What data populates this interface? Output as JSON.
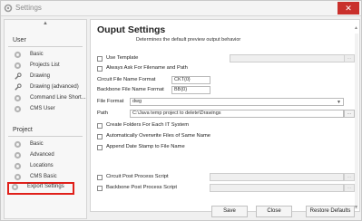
{
  "window": {
    "title": "Settings",
    "close_label": "✕"
  },
  "sidebar": {
    "scroll_up_icon": "▲",
    "sections": [
      {
        "title": "User",
        "items": [
          {
            "label": "Basic",
            "icon": "gear-icon"
          },
          {
            "label": "Projects List",
            "icon": "gear-icon"
          },
          {
            "label": "Drawing",
            "icon": "wrench-icon"
          },
          {
            "label": "Drawing (advanced)",
            "icon": "wrench-icon"
          },
          {
            "label": "Command Line Short...",
            "icon": "gear-icon"
          },
          {
            "label": "CMS User",
            "icon": "gear-icon"
          }
        ]
      },
      {
        "title": "Project",
        "items": [
          {
            "label": "Basic",
            "icon": "gear-icon"
          },
          {
            "label": "Advanced",
            "icon": "gear-icon"
          },
          {
            "label": "Locations",
            "icon": "gear-icon"
          },
          {
            "label": "CMS Basic",
            "icon": "gear-icon"
          },
          {
            "label": "Export Settings",
            "icon": "gear-icon",
            "selected": true
          }
        ]
      }
    ]
  },
  "main": {
    "title": "Ouput Settings",
    "subtitle": "Determines the default preview output behavior",
    "use_template": {
      "label": "Use Template",
      "checked": false,
      "value": "",
      "button": "..."
    },
    "always_ask": {
      "label": "Always Ask For Filename and Path",
      "checked": false
    },
    "circuit_format": {
      "label": "Circuit File Name Format",
      "value": "CKT{0}"
    },
    "backbone_format": {
      "label": "Backbone File Name Format",
      "value": "BB{0}"
    },
    "file_format": {
      "label": "File Format",
      "value": "dwg",
      "arrow": "▼"
    },
    "path": {
      "label": "Path",
      "value": "C:\\Java temp project to delete\\Drawings",
      "button": "..."
    },
    "create_folders": {
      "label": "Create Folders For Each IT System",
      "checked": false
    },
    "overwrite": {
      "label": "Automatically Overwrite Files of Same Name",
      "checked": false
    },
    "append_date": {
      "label": "Append Date Stamp to File Name",
      "checked": false
    },
    "circuit_post": {
      "label": "Circuit Post Process Script",
      "checked": false,
      "value": "",
      "button": "..."
    },
    "backbone_post": {
      "label": "Backbone Post Process Script",
      "checked": false,
      "value": "",
      "button": "..."
    },
    "scroll_up": "▲",
    "scroll_down": "▼"
  },
  "footer": {
    "save": "Save",
    "close": "Close",
    "restore": "Restore Defaults"
  }
}
